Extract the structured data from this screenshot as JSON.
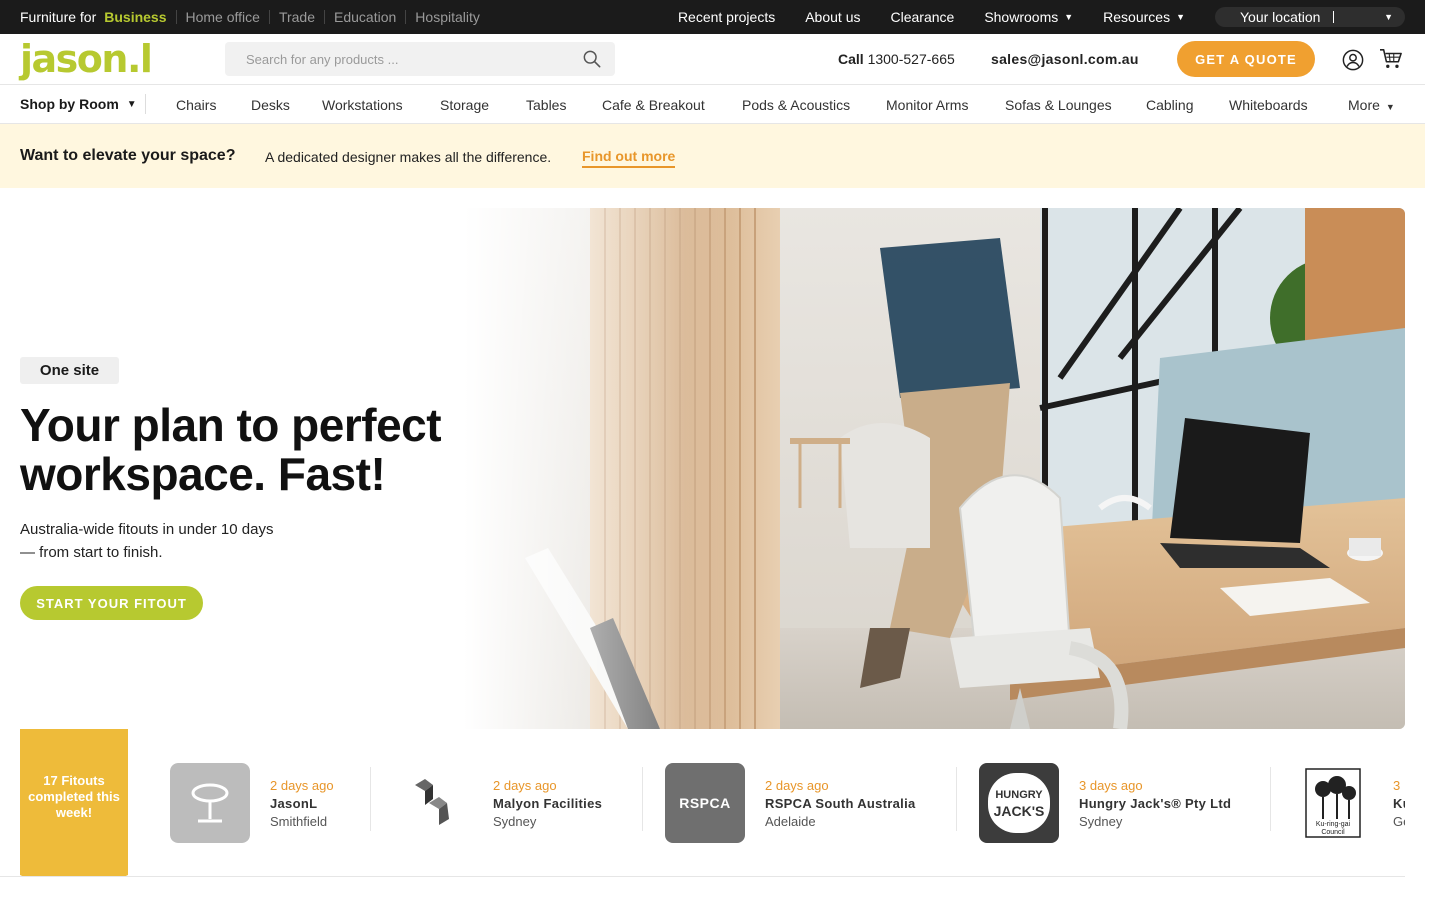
{
  "topbar": {
    "prefix": "Furniture for",
    "segments": [
      "Business",
      "Home office",
      "Trade",
      "Education",
      "Hospitality"
    ],
    "links": [
      "Recent projects",
      "About us",
      "Clearance",
      "Showrooms",
      "Resources"
    ],
    "location": "Your location"
  },
  "header": {
    "logo": "jason.l",
    "search_placeholder": "Search for any products ...",
    "call_label": "Call",
    "phone": "1300-527-665",
    "email": "sales@jasonl.com.au",
    "quote_button": "GET A QUOTE"
  },
  "catnav": {
    "shop_by": "Shop by Room",
    "items": [
      "Chairs",
      "Desks",
      "Workstations",
      "Storage",
      "Tables",
      "Cafe & Breakout",
      "Pods & Acoustics",
      "Monitor Arms",
      "Sofas & Lounges",
      "Cabling",
      "Whiteboards",
      "More"
    ]
  },
  "promo": {
    "title": "Want to elevate your space?",
    "desc": "A dedicated designer makes all the difference.",
    "link": "Find out more"
  },
  "hero": {
    "badge": "One site",
    "title": "Your plan to perfect workspace. Fast!",
    "subtitle_line1": "Australia-wide fitouts in under 10 days",
    "subtitle_line2": "— from start to finish.",
    "cta": "START YOUR FITOUT"
  },
  "ticker": {
    "flag": "17 Fitouts completed this week!",
    "items": [
      {
        "when": "2 days ago",
        "name": "JasonL",
        "city": "Smithfield"
      },
      {
        "when": "2 days ago",
        "name": "Malyon Facilities",
        "city": "Sydney"
      },
      {
        "when": "2 days ago",
        "name": "RSPCA South Australia",
        "city": "Adelaide",
        "logo_text": "RSPCA"
      },
      {
        "when": "3 days ago",
        "name": "Hungry Jack's® Pty Ltd",
        "city": "Sydney",
        "logo_text_1": "HUNGRY",
        "logo_text_2": "JACK'S"
      },
      {
        "when": "3",
        "name": "Ku",
        "city": "Ge",
        "logo_text_1": "Ku-ring-gai",
        "logo_text_2": "Council"
      }
    ]
  },
  "colors": {
    "brand_green": "#b7c930",
    "accent_orange": "#f0a030",
    "promo_bg": "#fff7df",
    "flag_yellow": "#eebb3a"
  }
}
